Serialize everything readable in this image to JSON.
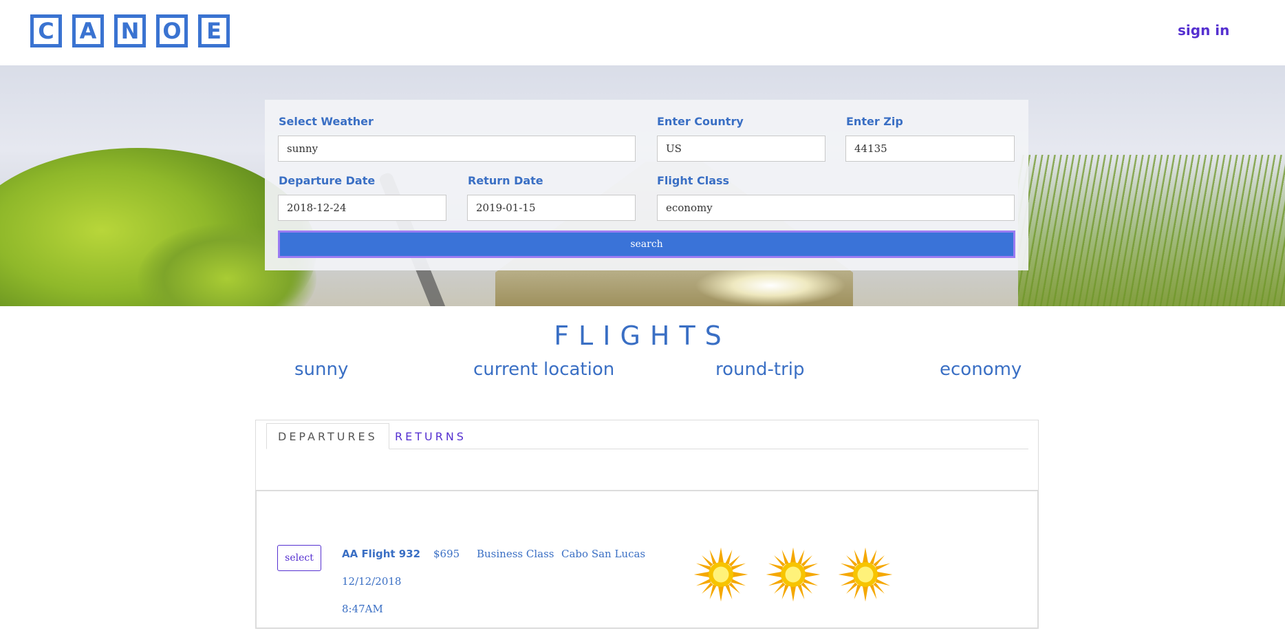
{
  "header": {
    "logo_letters": [
      "C",
      "A",
      "N",
      "O",
      "E"
    ],
    "sign_in_label": "sign in"
  },
  "search_form": {
    "weather": {
      "label": "Select Weather",
      "value": "sunny"
    },
    "country": {
      "label": "Enter Country",
      "value": "US"
    },
    "zip": {
      "label": "Enter Zip",
      "value": "44135"
    },
    "departure": {
      "label": "Departure Date",
      "value": "2018-12-24"
    },
    "return": {
      "label": "Return Date",
      "value": "2019-01-15"
    },
    "flight_class": {
      "label": "Flight Class",
      "value": "economy"
    },
    "search_label": "search"
  },
  "flights": {
    "title": "FLIGHTS",
    "summary": [
      "sunny",
      "current location",
      "round-trip",
      "economy"
    ]
  },
  "tabs": [
    {
      "label": "DEPARTURES",
      "active": true
    },
    {
      "label": "RETURNS",
      "active": false
    }
  ],
  "results": [
    {
      "select_label": "select",
      "flight": "AA Flight 932",
      "price": "$695",
      "class": "Business Class",
      "destination": "Cabo San Lucas",
      "date": "12/12/2018",
      "time": "8:47AM",
      "weather_icons": [
        "sun-icon",
        "sun-icon",
        "sun-icon"
      ]
    }
  ],
  "colors": {
    "accent_blue": "#3a73d1",
    "link_purple": "#5530d0",
    "search_button": "#3a73d8",
    "search_button_border": "#9b7cf2"
  }
}
